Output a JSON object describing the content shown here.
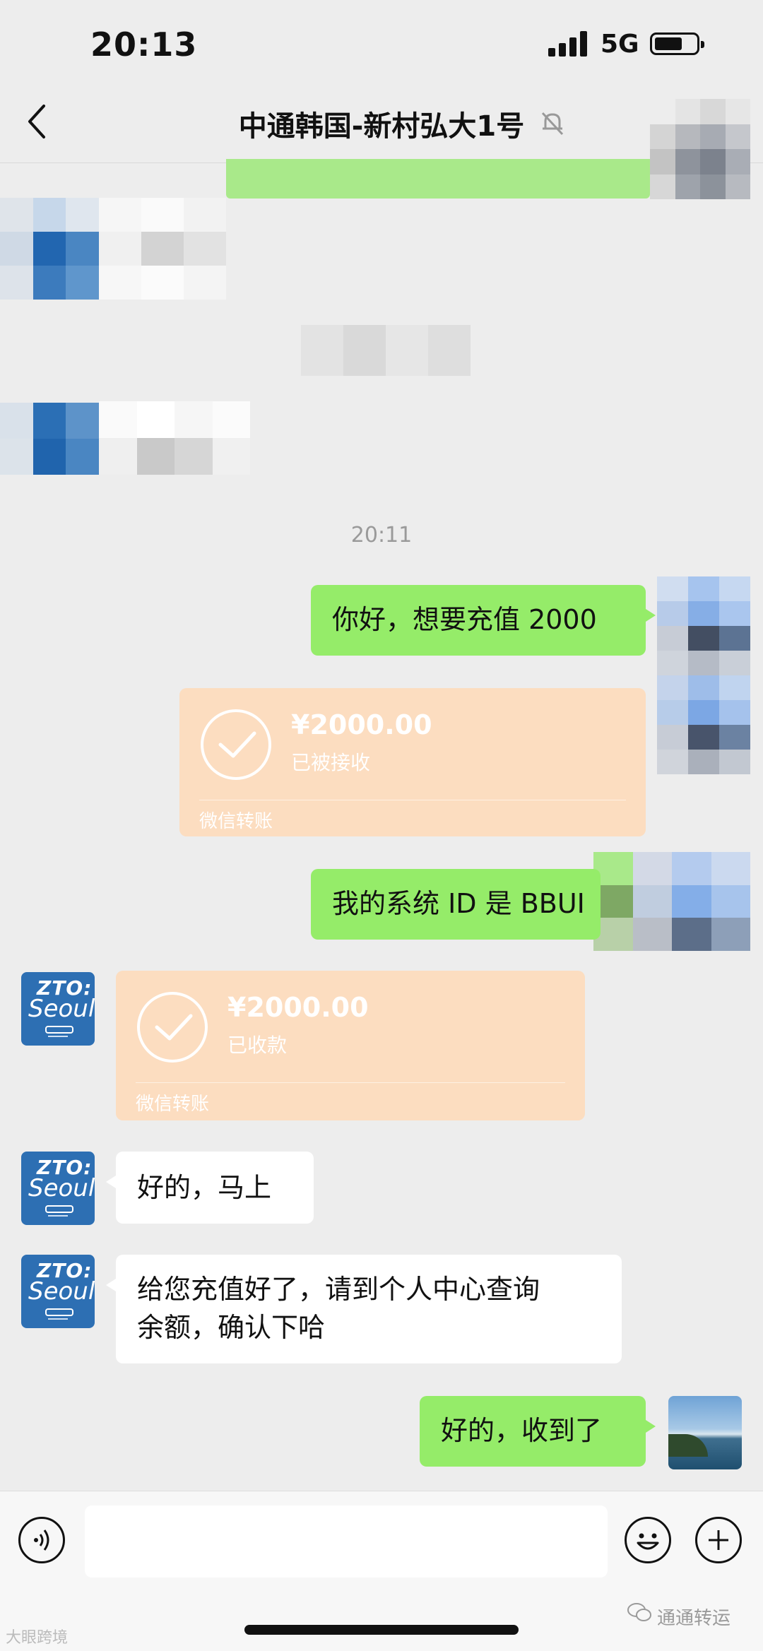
{
  "status_bar": {
    "time": "20:13",
    "network": "5G"
  },
  "header": {
    "title": "中通韩国-新村弘大1号"
  },
  "chat": {
    "timestamp": "20:11",
    "messages": [
      {
        "id": "m1",
        "side": "right",
        "type": "text",
        "text": "你好，想要充值 2000"
      },
      {
        "id": "m2",
        "side": "right",
        "type": "transfer",
        "amount": "¥2000.00",
        "status": "已被接收",
        "brand": "微信转账"
      },
      {
        "id": "m3",
        "side": "right",
        "type": "text",
        "text": "我的系统 ID 是 BBUI"
      },
      {
        "id": "m4",
        "side": "left",
        "type": "transfer",
        "amount": "¥2000.00",
        "status": "已收款",
        "brand": "微信转账"
      },
      {
        "id": "m5",
        "side": "left",
        "type": "text",
        "text": "好的，马上"
      },
      {
        "id": "m6",
        "side": "left",
        "type": "text",
        "lines": [
          "给您充值好了，请到个人中心查询",
          "余额，确认下哈"
        ]
      },
      {
        "id": "m7",
        "side": "right",
        "type": "text",
        "text": "好的，收到了"
      }
    ]
  },
  "avatar_zto": {
    "line1": "ZTO:",
    "line2": "Seoul"
  },
  "watermarks": {
    "left": "大眼跨境",
    "right": "通通转运"
  },
  "icons": [
    "back-arrow-icon",
    "mute-bell-icon",
    "voice-icon",
    "emoji-icon",
    "plus-icon",
    "check-icon"
  ],
  "colors": {
    "bubble_green": "#95ec69",
    "transfer_card": "#fcddc0",
    "background": "#ededed"
  }
}
